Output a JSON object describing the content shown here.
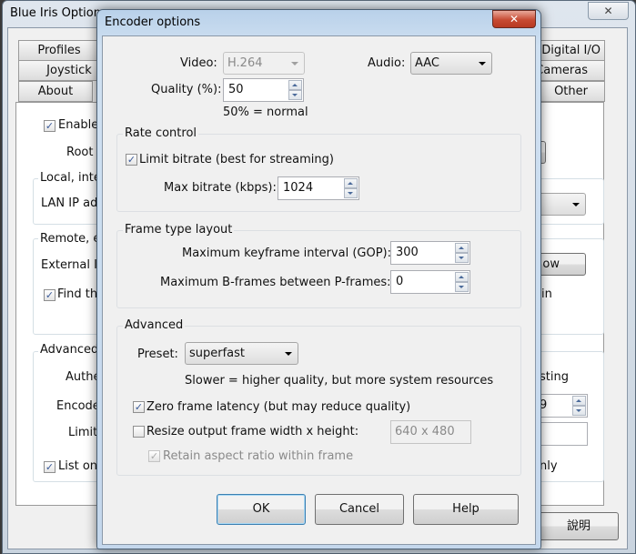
{
  "parent_window": {
    "title": "Blue Iris Options",
    "close_icon": "close-icon",
    "tabs_left": [
      "Profiles",
      "Joystick",
      "About"
    ],
    "tabs_right": [
      "Digital I/O",
      "Cameras",
      "Other"
    ],
    "enable_label": "Enable",
    "root_label": "Root",
    "local_group": "Local, inte",
    "lan_ip_label": "LAN IP ad",
    "remote_group": "Remote, e",
    "external_ip_label": "External II",
    "show_button_fragment": "ow",
    "find_label": "Find th",
    "find_label_tail": "in",
    "advanced_group": "Advanced",
    "auth_label": "Authe",
    "auth_tail": "sting",
    "encoder_label": "Encode",
    "encoder_value": "9",
    "limit_label": "Limit",
    "list_label": "List on",
    "list_tail": "nly",
    "help_button": "說明"
  },
  "dialog": {
    "title": "Encoder options",
    "video_label": "Video:",
    "video_value": "H.264",
    "audio_label": "Audio:",
    "audio_value": "AAC",
    "quality_label": "Quality (%):",
    "quality_value": "50",
    "quality_note": "50% = normal",
    "rate_control": {
      "title": "Rate control",
      "limit_bitrate_label": "Limit bitrate (best for streaming)",
      "limit_bitrate_checked": true,
      "max_bitrate_label": "Max bitrate (kbps):",
      "max_bitrate_value": "1024"
    },
    "frame_type": {
      "title": "Frame type layout",
      "gop_label": "Maximum keyframe interval (GOP):",
      "gop_value": "300",
      "bframes_label": "Maximum B-frames between P-frames:",
      "bframes_value": "0"
    },
    "advanced": {
      "title": "Advanced",
      "preset_label": "Preset:",
      "preset_value": "superfast",
      "preset_note": "Slower = higher quality, but more system resources",
      "zero_latency_label": "Zero frame latency (but may reduce quality)",
      "zero_latency_checked": true,
      "resize_label": "Resize output frame width x height:",
      "resize_checked": false,
      "resize_value": "640 x 480",
      "retain_aspect_label": "Retain aspect ratio within frame",
      "retain_aspect_checked": true
    },
    "buttons": {
      "ok": "OK",
      "cancel": "Cancel",
      "help": "Help"
    }
  }
}
